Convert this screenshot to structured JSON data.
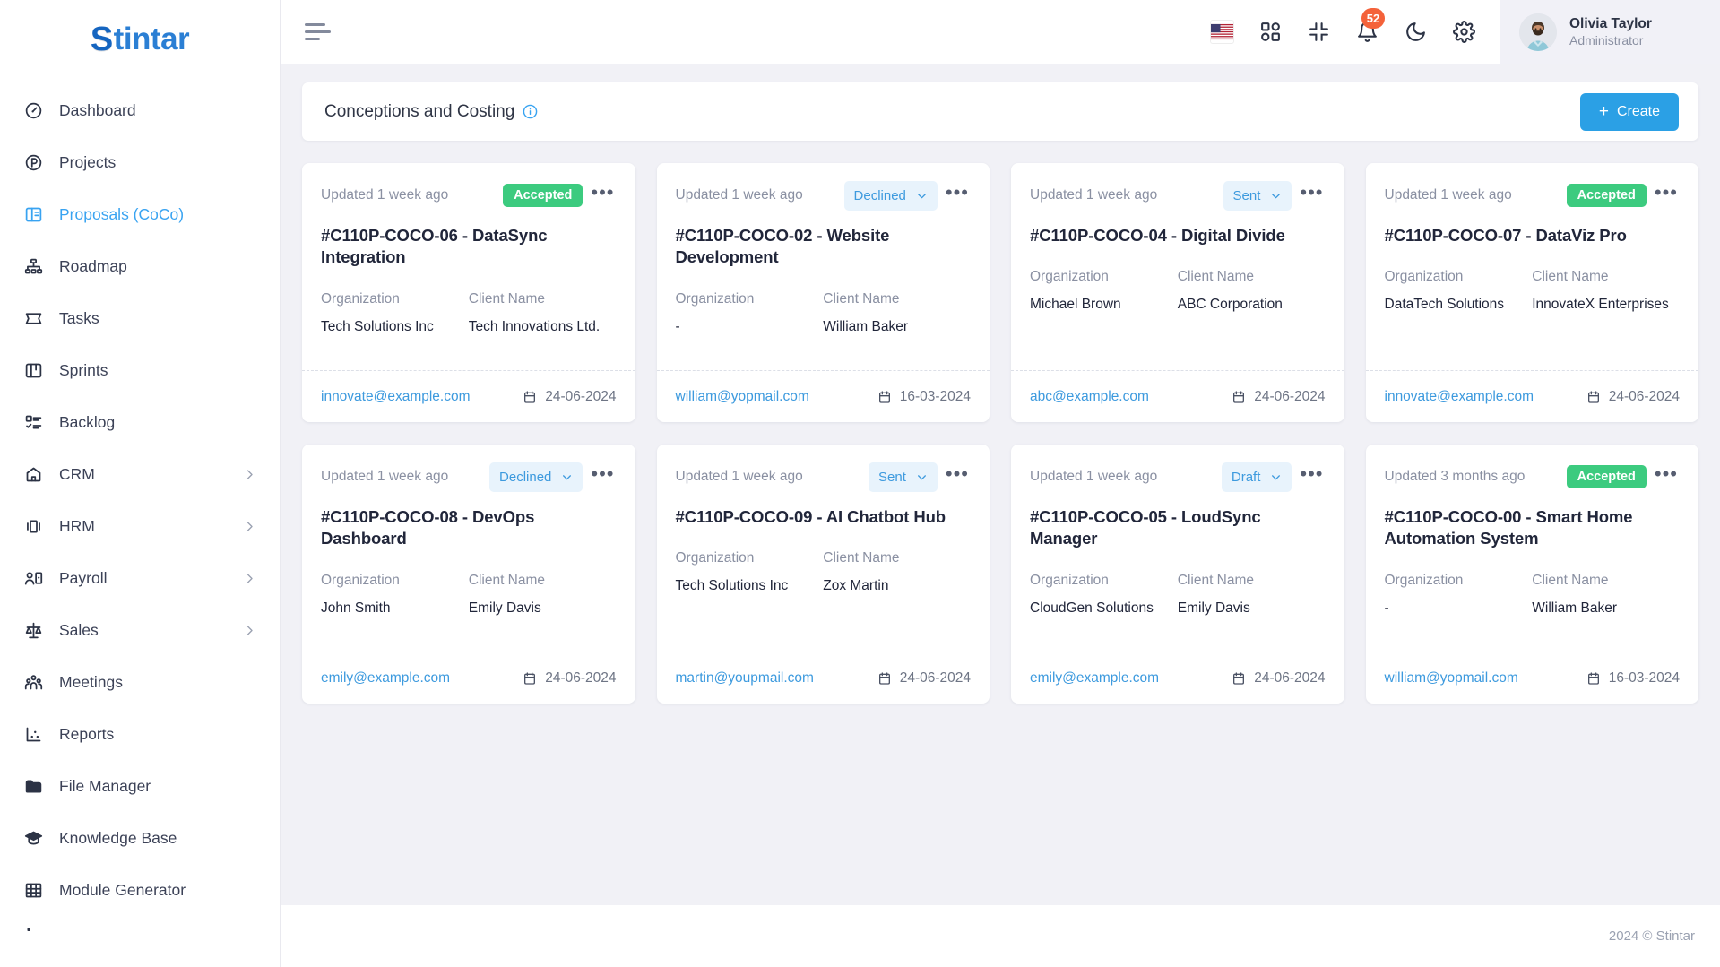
{
  "brand": {
    "mark": "S",
    "name": "tintar",
    "full": "Stintar"
  },
  "sidebar": {
    "items": [
      {
        "label": "Dashboard",
        "icon": "gauge-icon",
        "active": false,
        "hasChevron": false
      },
      {
        "label": "Projects",
        "icon": "projects-icon",
        "active": false,
        "hasChevron": false
      },
      {
        "label": "Proposals (CoCo)",
        "icon": "proposals-icon",
        "active": true,
        "hasChevron": false
      },
      {
        "label": "Roadmap",
        "icon": "roadmap-icon",
        "active": false,
        "hasChevron": false
      },
      {
        "label": "Tasks",
        "icon": "tasks-icon",
        "active": false,
        "hasChevron": false
      },
      {
        "label": "Sprints",
        "icon": "sprints-icon",
        "active": false,
        "hasChevron": false
      },
      {
        "label": "Backlog",
        "icon": "backlog-icon",
        "active": false,
        "hasChevron": false
      },
      {
        "label": "CRM",
        "icon": "crm-icon",
        "active": false,
        "hasChevron": true
      },
      {
        "label": "HRM",
        "icon": "hrm-icon",
        "active": false,
        "hasChevron": true
      },
      {
        "label": "Payroll",
        "icon": "payroll-icon",
        "active": false,
        "hasChevron": true
      },
      {
        "label": "Sales",
        "icon": "sales-icon",
        "active": false,
        "hasChevron": true
      },
      {
        "label": "Meetings",
        "icon": "meetings-icon",
        "active": false,
        "hasChevron": false
      },
      {
        "label": "Reports",
        "icon": "reports-icon",
        "active": false,
        "hasChevron": false
      },
      {
        "label": "File Manager",
        "icon": "folder-icon",
        "active": false,
        "hasChevron": false
      },
      {
        "label": "Knowledge Base",
        "icon": "graduation-cap-icon",
        "active": false,
        "hasChevron": false
      },
      {
        "label": "Module Generator",
        "icon": "grid-table-icon",
        "active": false,
        "hasChevron": false
      },
      {
        "label": "",
        "icon": "cut-off-icon",
        "active": false,
        "hasChevron": false
      }
    ]
  },
  "topbar": {
    "menu_toggle": "hamburger-icon",
    "icons": [
      {
        "name": "language-flag-us",
        "label": "US"
      },
      {
        "name": "apps-grid-icon",
        "label": "Apps"
      },
      {
        "name": "fullscreen-exit-icon",
        "label": "Compress"
      },
      {
        "name": "notifications-bell-icon",
        "label": "Notifications",
        "badge": "52"
      },
      {
        "name": "dark-mode-moon-icon",
        "label": "Dark mode"
      },
      {
        "name": "settings-gear-icon",
        "label": "Settings"
      }
    ],
    "notification_count": "52",
    "profile": {
      "name": "Olivia Taylor",
      "role": "Administrator"
    }
  },
  "panel": {
    "title": "Conceptions and Costing",
    "info_icon": "info-circle-icon",
    "create_label": "Create",
    "create_plus": "+"
  },
  "labels": {
    "organization": "Organization",
    "client_name": "Client Name"
  },
  "cards": [
    {
      "updated": "Updated 1 week ago",
      "status": "Accepted",
      "status_type": "pill",
      "title": "#C110P-COCO-06 - DataSync Integration",
      "organization": "Tech Solutions Inc",
      "client": "Tech Innovations Ltd.",
      "email": "innovate@example.com",
      "date": "24-06-2024"
    },
    {
      "updated": "Updated 1 week ago",
      "status": "Declined",
      "status_type": "select",
      "title": "#C110P-COCO-02 - Website Development",
      "organization": "-",
      "client": "William Baker",
      "email": "william@yopmail.com",
      "date": "16-03-2024"
    },
    {
      "updated": "Updated 1 week ago",
      "status": "Sent",
      "status_type": "select",
      "title": "#C110P-COCO-04 - Digital Divide",
      "organization": "Michael Brown",
      "client": "ABC Corporation",
      "email": "abc@example.com",
      "date": "24-06-2024"
    },
    {
      "updated": "Updated 1 week ago",
      "status": "Accepted",
      "status_type": "pill",
      "title": "#C110P-COCO-07 - DataViz Pro",
      "organization": "DataTech Solutions",
      "client": "InnovateX Enterprises",
      "email": "innovate@example.com",
      "date": "24-06-2024"
    },
    {
      "updated": "Updated 1 week ago",
      "status": "Declined",
      "status_type": "select",
      "title": "#C110P-COCO-08 - DevOps Dashboard",
      "organization": "John Smith",
      "client": "Emily Davis",
      "email": "emily@example.com",
      "date": "24-06-2024"
    },
    {
      "updated": "Updated 1 week ago",
      "status": "Sent",
      "status_type": "select",
      "title": "#C110P-COCO-09 - AI Chatbot Hub",
      "organization": "Tech Solutions Inc",
      "client": "Zox Martin",
      "email": "martin@youpmail.com",
      "date": "24-06-2024"
    },
    {
      "updated": "Updated 1 week ago",
      "status": "Draft",
      "status_type": "select",
      "title": "#C110P-COCO-05 - LoudSync Manager",
      "organization": "CloudGen Solutions",
      "client": "Emily Davis",
      "email": "emily@example.com",
      "date": "24-06-2024"
    },
    {
      "updated": "Updated 3 months ago",
      "status": "Accepted",
      "status_type": "pill",
      "title": "#C110P-COCO-00 - Smart Home Automation System",
      "organization": "-",
      "client": "William Baker",
      "email": "william@yopmail.com",
      "date": "16-03-2024"
    }
  ],
  "footer": {
    "copyright": "2024 © Stintar"
  },
  "colors": {
    "accent": "#2ba0e5",
    "active_nav": "#38a3f1",
    "accepted_green": "#3ccb7f",
    "badge_red": "#f4623a",
    "page_bg": "#f1f1f6"
  }
}
